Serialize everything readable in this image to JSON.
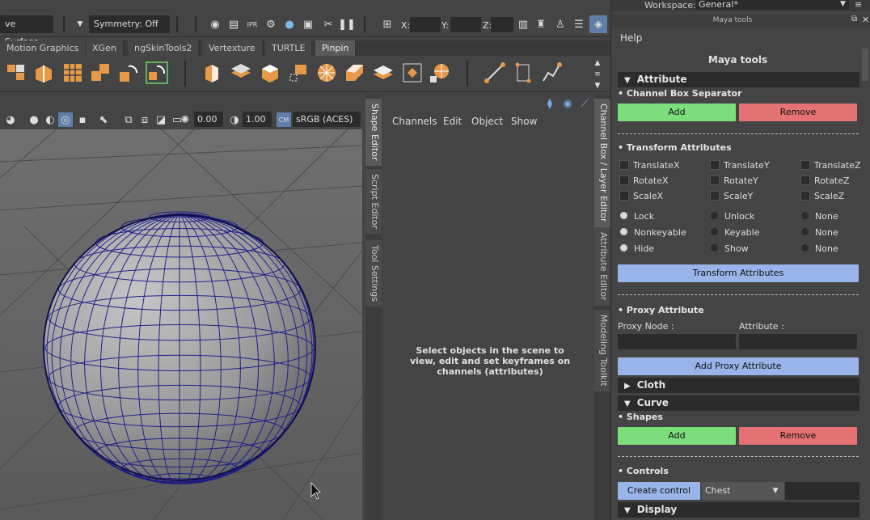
{
  "statusline": {
    "surface_field": "ve Surface",
    "symmetry": "Symmetry: Off",
    "x_label": "X:",
    "y_label": "Y:",
    "z_label": "Z:",
    "workspace_label": "Workspace:",
    "workspace_value": "General*"
  },
  "shelf": {
    "tabs": [
      "Motion Graphics",
      "XGen",
      "ngSkinTools2",
      "Vertexture",
      "TURTLE",
      "Pinpin"
    ],
    "active_tab": "Pinpin"
  },
  "viewport": {
    "exposure": "0.00",
    "gamma": "1.00",
    "colorspace": "sRGB (ACES)"
  },
  "side_tabs": {
    "left": [
      "Shape Editor",
      "Script Editor",
      "Tool Settings"
    ],
    "right": [
      "Channel Box / Layer Editor",
      "Attribute Editor",
      "Modeling Toolkit"
    ]
  },
  "channel_box": {
    "menus": [
      "Channels",
      "Edit",
      "Object",
      "Show"
    ],
    "empty_message": "Select objects in the scene to view, edit and set keyframes on channels (attributes)"
  },
  "maya_tools": {
    "window_title": "Maya tools",
    "menu_help": "Help",
    "heading": "Maya tools",
    "attribute_frame": "Attribute",
    "channel_box_separator": "• Channel Box Separator",
    "add": "Add",
    "remove": "Remove",
    "transform_attributes_label": "• Transform Attributes",
    "checkboxes": [
      "TranslateX",
      "TranslateY",
      "TranslateZ",
      "RotateX",
      "RotateY",
      "RotateZ",
      "ScaleX",
      "ScaleY",
      "ScaleZ"
    ],
    "radios": [
      "Lock",
      "Unlock",
      "None",
      "Nonkeyable",
      "Keyable",
      "None",
      "Hide",
      "Show",
      "None"
    ],
    "transform_attributes_button": "Transform Attributes",
    "proxy_attribute_label": "• Proxy Attribute",
    "proxy_node_label": "Proxy Node :",
    "attribute_label": "Attribute :",
    "add_proxy_button": "Add Proxy Attribute",
    "cloth_frame": "Cloth",
    "curve_frame": "Curve",
    "shapes_label": "• Shapes",
    "shapes_add": "Add",
    "shapes_remove": "Remove",
    "controls_label": "• Controls",
    "create_control_button": "Create control",
    "control_shape": "Chest",
    "display_frame": "Display"
  },
  "colors": {
    "add_green": "#7cdd7c",
    "remove_red": "#e47272",
    "action_blue": "#99b4e8",
    "wire_blue": "#1a1a8a"
  }
}
